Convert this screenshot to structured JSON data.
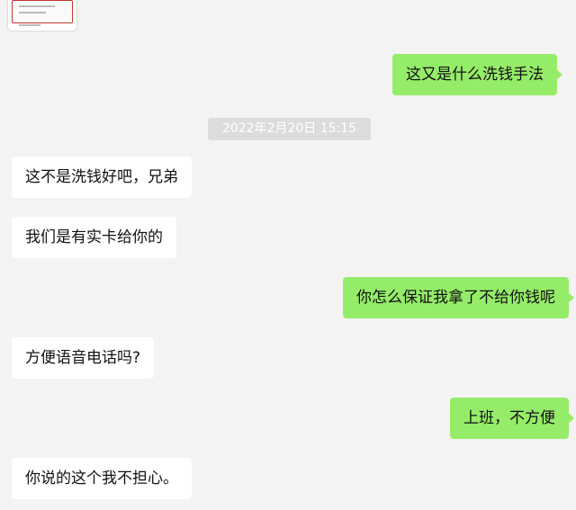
{
  "timestamp": "2022年2月20日 15:15",
  "messages": [
    {
      "side": "out",
      "text": "这又是什么洗钱手法"
    },
    {
      "side": "in",
      "text": "这不是洗钱好吧，兄弟"
    },
    {
      "side": "in",
      "text": "我们是有实卡给你的"
    },
    {
      "side": "out",
      "text": "你怎么保证我拿了不给你钱呢"
    },
    {
      "side": "in",
      "text": "方便语音电话吗?"
    },
    {
      "side": "out",
      "text": "上班，不方便"
    },
    {
      "side": "in",
      "text": "你说的这个我不担心。"
    }
  ],
  "colors": {
    "background": "#f3f3f3",
    "incoming_bubble": "#ffffff",
    "outgoing_bubble": "#95ec69",
    "timestamp_bg": "#dcdcdc"
  }
}
